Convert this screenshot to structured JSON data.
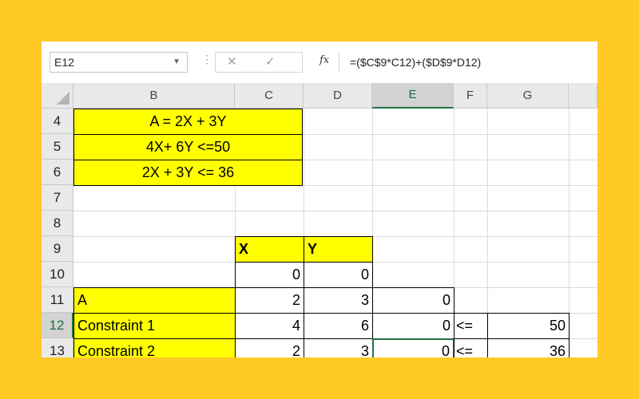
{
  "formula_bar": {
    "name_box": "E12",
    "cancel_symbol": "✕",
    "enter_symbol": "✓",
    "fx_label": "fx",
    "formula": "=($C$9*C12)+($D$9*D12)"
  },
  "columns": [
    "B",
    "C",
    "D",
    "E",
    "F",
    "G"
  ],
  "selected_column": "E",
  "rows": [
    "4",
    "5",
    "6",
    "7",
    "8",
    "9",
    "10",
    "11",
    "12",
    "13"
  ],
  "selected_row": "12",
  "cells": {
    "B4": "A = 2X + 3Y",
    "B5": "4X+ 6Y <=50",
    "B6": "2X + 3Y <= 36",
    "C8": "X",
    "D8": "Y",
    "C9": "0",
    "D9": "0",
    "B10": "A",
    "C10": "2",
    "D10": "3",
    "E10": "0",
    "B11": "Constraint 1",
    "C11": "4",
    "D11": "6",
    "E11": "0",
    "F11": "<=",
    "G11": "50",
    "B12": "Constraint 2",
    "C12": "2",
    "D12": "3",
    "E12": "0",
    "F12": "<=",
    "G12": "36"
  },
  "colors": {
    "background": "#FFC926",
    "highlight": "#FFFF00",
    "selection": "#217346"
  },
  "icons": {
    "quick_analysis": "quick-analysis-icon"
  }
}
